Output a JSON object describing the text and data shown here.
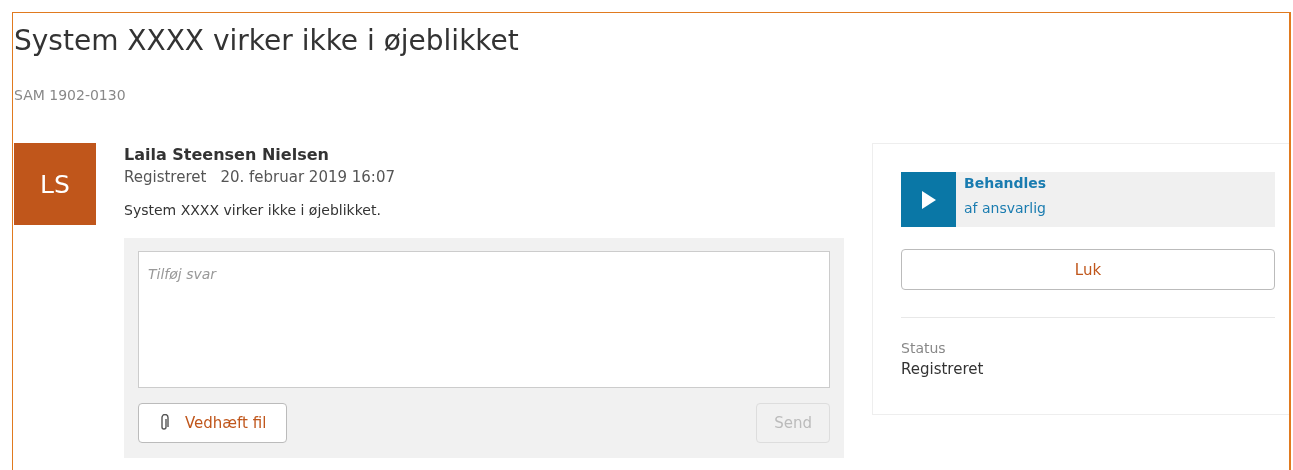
{
  "title": "System XXXX virker ikke i øjeblikket",
  "case_number": "SAM 1902-0130",
  "message": {
    "avatar_initials": "LS",
    "author": "Laila Steensen Nielsen",
    "event": "Registreret",
    "timestamp": "20. februar 2019 16:07",
    "body": "System XXXX virker ikke i øjeblikket."
  },
  "reply": {
    "placeholder": "Tilføj svar",
    "attach_button": "Vedhæft fil",
    "send_button": {
      "label": "Send",
      "disabled": true
    }
  },
  "side_panel": {
    "action": {
      "title": "Behandles",
      "subtitle": "af ansvarlig"
    },
    "close_button": "Luk",
    "status_label": "Status",
    "status_value": "Registreret"
  }
}
